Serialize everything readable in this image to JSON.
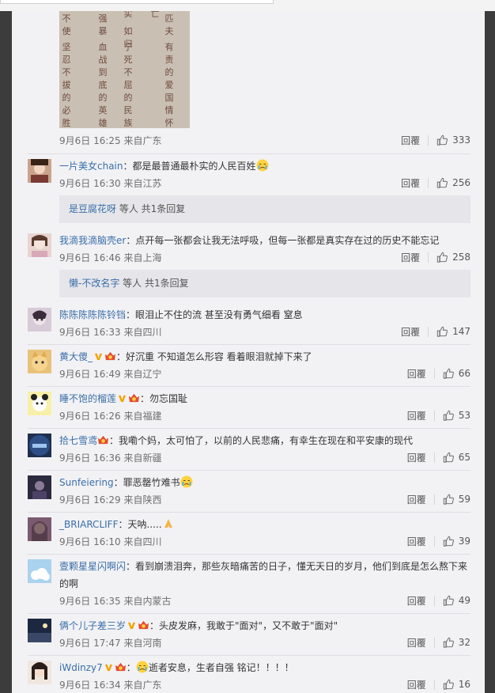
{
  "top": {
    "photo_text_columns": [
      "不使",
      "强暴",
      "实",
      "如归",
      "亡",
      "匹夫",
      "坚忍不拔的必胜信念",
      "血战到底的英雄气概",
      "宁死不屈的民族气节",
      "有责的爱国情怀"
    ]
  },
  "first": {
    "date": "9月6日 16:25 来自广东",
    "reply": "回覆",
    "likes": "333"
  },
  "comments": [
    {
      "name": "一片美女chain",
      "sep": "：",
      "text": "都是最普通最朴实的人民百姓",
      "emoji": "cry-emoji",
      "date": "9月6日 16:30 来自江苏",
      "reply": "回覆",
      "likes": "256",
      "sub": {
        "who": "是豆腐花呀",
        "rest": " 等人 共1条回复"
      }
    },
    {
      "name": "我滴我滴脑壳er",
      "sep": "：",
      "text": "点开每一张都会让我无法呼吸，但每一张都是真实存在过的历史不能忘记",
      "date": "9月6日 16:46 来自上海",
      "reply": "回覆",
      "likes": "258",
      "sub": {
        "who": "懒-不改名字",
        "rest": " 等人 共1条回复"
      }
    },
    {
      "name": "陈陈陈陈陈铃铛",
      "sep": "：",
      "text": "眼泪止不住的流 甚至没有勇气细看 窒息",
      "date": "9月6日 16:33 来自四川",
      "reply": "回覆",
      "likes": "147"
    },
    {
      "name": "黄大傻_",
      "sep": "：",
      "text": "好沉重 不知道怎么形容 看着眼泪就掉下来了",
      "date": "9月6日 16:49 来自辽宁",
      "reply": "回覆",
      "likes": "66"
    },
    {
      "name": "睡不饱的榴莲",
      "sep": "：",
      "text": "勿忘国耻",
      "date": "9月6日 16:26 来自福建",
      "reply": "回覆",
      "likes": "53"
    },
    {
      "name": "拾七雪鸢",
      "sep": "：",
      "text": "我嘞个妈，太可怕了，以前的人民悲痛，有幸生在现在和平安康的现代",
      "date": "9月6日 16:36 来自新疆",
      "reply": "回覆",
      "likes": "65"
    },
    {
      "name": "Sunfeiering",
      "sep": "：",
      "text": "罪恶罄竹难书",
      "emoji": "cry-emoji",
      "date": "9月6日 16:29 来自陕西",
      "reply": "回覆",
      "likes": "59"
    },
    {
      "name": "_BRIARCLIFF",
      "sep": "：",
      "text": "天呐.....",
      "emoji": "pray-emoji",
      "date": "9月6日 16:10 来自四川",
      "reply": "回覆",
      "likes": "39"
    },
    {
      "name": "壹颗星星闪啊闪",
      "sep": "：",
      "text": "看到崩溃泪奔，那些灰暗痛苦的日子，懂无天日的岁月，他们到底是怎么熬下来的啊",
      "date": "9月6日 16:35 来自内蒙古",
      "reply": "回覆",
      "likes": "49"
    },
    {
      "name": "俩个儿子差三岁",
      "sep": "：",
      "text": "头皮发麻，我敢于\"面对\"，又不敢于\"面对\"",
      "date": "9月6日 17:47 来自河南",
      "reply": "回覆",
      "likes": "32"
    },
    {
      "name": "iWdinzy7",
      "sep": "：",
      "text": "逝者安息，生者自强 铭记！！！！",
      "emoji": "cry-emoji",
      "date": "9月6日 16:34 来自广东",
      "reply": "回覆",
      "likes": "16"
    }
  ],
  "colors": {
    "link": "#3a6ea8",
    "vip_orange": "#f0a400",
    "crown_red": "#e64b2e"
  }
}
